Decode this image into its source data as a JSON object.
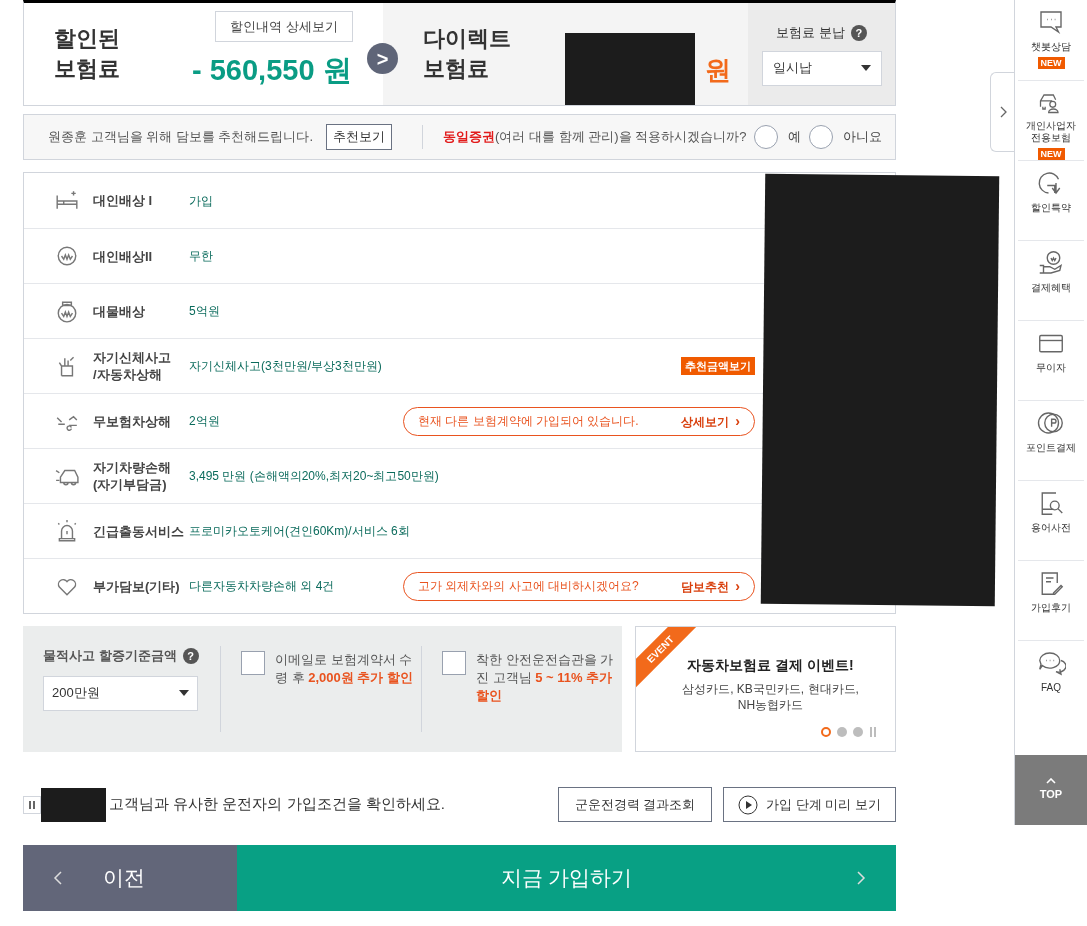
{
  "summary": {
    "discount_title": "할인된\n보험료",
    "discount_button": "할인내역 상세보기",
    "discount_amount": "- 560,550 원",
    "arrow": ">",
    "direct_title": "다이렉트\n보험료",
    "direct_unit": "원",
    "payment_label": "보험료 분납",
    "payment_help": "?",
    "payment_value": "일시납"
  },
  "recommend_bar": {
    "text": "원종훈 고객님을 위해 담보를 추천해드립니다.",
    "button": "추천보기",
    "question": "**동일증권**(여러 대를 함께 관리)을 적용하시겠습니까?",
    "options": [
      {
        "label": "예",
        "selected": false
      },
      {
        "label": "아니요",
        "selected": false
      }
    ]
  },
  "coverages": [
    {
      "name": "대인배상 I",
      "value": "가입"
    },
    {
      "name": "대인배상II",
      "value": "무한"
    },
    {
      "name": "대물배상",
      "value": "5억원"
    },
    {
      "name": "자기신체사고\n/자동차상해",
      "value": "자기신체사고(3천만원/부상3천만원)",
      "action": {
        "kind": "badge",
        "label": "추천금액보기"
      }
    },
    {
      "name": "무보험차상해",
      "value": "2억원",
      "action": {
        "kind": "notice",
        "text": "현재 다른 보험계약에 가입되어 있습니다.",
        "link": "상세보기",
        "chevron": "›"
      }
    },
    {
      "name": "자기차량손해\n(자기부담금)",
      "value": "3,495 만원 (손해액의20%,최저20~최고50만원)"
    },
    {
      "name": "긴급출동서비스",
      "value": "프로미카오토케어(견인60Km)/서비스 6회"
    },
    {
      "name": "부가담보(기타)",
      "value": "다른자동차차량손해 외 4건",
      "action": {
        "kind": "notice",
        "text": "고가 외제차와의 사고에 대비하시겠어요?",
        "link": "담보추천",
        "chevron": "›"
      }
    }
  ],
  "options_panel": {
    "deductible_label": "물적사고 할증기준금액",
    "deductible_help": "?",
    "deductible_value": "200만원",
    "checks": [
      {
        "text": "이메일로 보험계약서 수령 후 **2,000원 추가 할인**",
        "checked": false
      },
      {
        "text": "착한 안전운전습관을 가진 고객님 **5 ~ 11% 추가 할인**",
        "checked": false
      }
    ]
  },
  "event": {
    "ribbon": "EVENT",
    "title": "자동차보험료 결제 이벤트!",
    "text": "삼성카드, KB국민카드, 현대카드,\nNH농협카드",
    "dots": [
      {
        "selected": true
      },
      {
        "selected": false
      },
      {
        "selected": false
      }
    ]
  },
  "similar": {
    "text": "고객님과 유사한 운전자의 가입조건을 확인하세요.",
    "buttons": [
      "군운전경력 결과조회",
      "가입 단계 미리 보기"
    ]
  },
  "nav": {
    "prev": "이전",
    "next": "지금 가입하기"
  },
  "sidebar": {
    "items": [
      {
        "label": "챗봇상담",
        "new": "NEW"
      },
      {
        "label": "개인사업자\n전용보험",
        "new": "NEW"
      },
      {
        "label": "할인특약"
      },
      {
        "label": "결제혜택"
      },
      {
        "label": "무이자"
      },
      {
        "label": "포인트결제"
      },
      {
        "label": "용어사전"
      },
      {
        "label": "가입후기"
      },
      {
        "label": "FAQ"
      }
    ],
    "top": "TOP"
  }
}
